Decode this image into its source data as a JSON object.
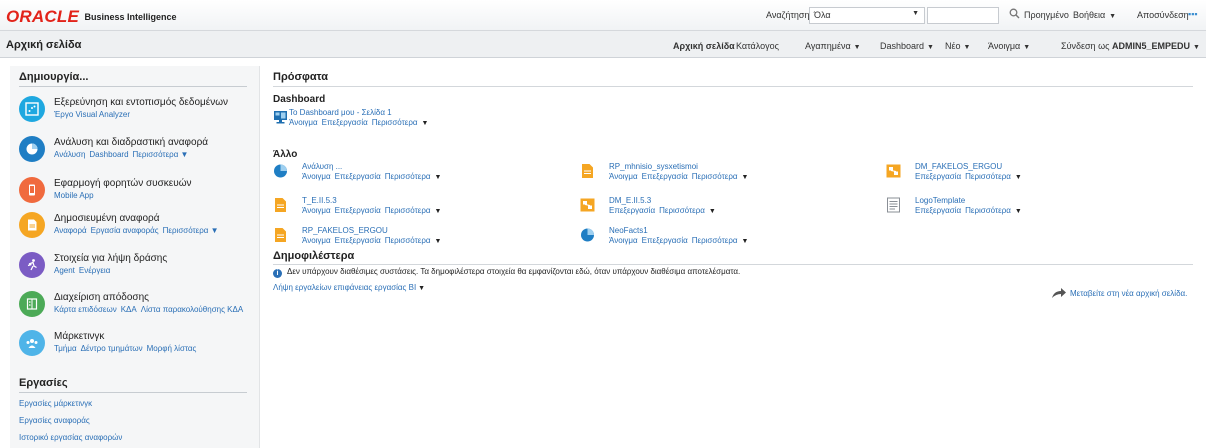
{
  "brand": {
    "oracle": "ORACLE",
    "product": "Business Intelligence",
    "color": "#e2231a"
  },
  "topbar": {
    "search_label": "Αναζήτηση",
    "search_scope": "Όλα",
    "search_value": "",
    "advanced": "Προηγμένο",
    "help": "Βοήθεια",
    "logout": "Αποσύνδεση",
    "dots": "▪▪▪",
    "icons": {
      "search": "search-icon",
      "chevron": "chevron-down-icon"
    }
  },
  "navbar": {
    "page_title": "Αρχική σελίδα",
    "home": "Αρχική σελίδα",
    "catalog": "Κατάλογος",
    "favorites": "Αγαπημένα",
    "dashboards": "Dashboard",
    "new": "Νέο",
    "open": "Άνοιγμα",
    "signed_in_prefix": "Σύνδεση ως",
    "user": "ADMIN5_EMPEDU"
  },
  "create": {
    "heading": "Δημιουργία...",
    "items": [
      {
        "title": "Εξερεύνηση και εντοπισμός δεδομένων",
        "links": [
          "Έργο Visual Analyzer"
        ],
        "icon": "data-explore-icon",
        "color": "#1fa8e0"
      },
      {
        "title": "Ανάλυση και διαδραστική αναφορά",
        "links": [
          "Ανάλυση",
          "Dashboard",
          "Περισσότερα ▼"
        ],
        "icon": "analysis-icon",
        "color": "#1f7ec4"
      },
      {
        "title": "Εφαρμογή φορητών συσκευών",
        "links": [
          "Mobile App"
        ],
        "icon": "mobile-icon",
        "color": "#f06a3e"
      },
      {
        "title": "Δημοσιευμένη αναφορά",
        "links": [
          "Αναφορά",
          "Εργασία αναφοράς",
          "Περισσότερα ▼"
        ],
        "icon": "published-report-icon",
        "color": "#f5a623"
      },
      {
        "title": "Στοιχεία για λήψη δράσης",
        "links": [
          "Agent",
          "Ενέργεια"
        ],
        "icon": "action-icon",
        "color": "#7b5cc4"
      },
      {
        "title": "Διαχείριση απόδοσης",
        "links": [
          "Κάρτα επιδόσεων",
          "ΚΔΑ",
          "Λίστα παρακολούθησης ΚΔΑ"
        ],
        "icon": "performance-icon",
        "color": "#4caa57"
      },
      {
        "title": "Μάρκετινγκ",
        "links": [
          "Τμήμα",
          "Δέντρο τμημάτων",
          "Μορφή λίστας"
        ],
        "icon": "marketing-icon",
        "color": "#4fb4e8"
      }
    ]
  },
  "tasks": {
    "heading": "Εργασίες",
    "links": [
      "Εργασίες μάρκετινγκ",
      "Εργασίες αναφοράς",
      "Ιστορικό εργασίας αναφορών"
    ]
  },
  "recent": {
    "heading": "Πρόσφατα",
    "dashboard_heading": "Dashboard",
    "dashboard_item": {
      "name": "Το Dashboard μου - Σελίδα 1",
      "actions": [
        "Άνοιγμα",
        "Επεξεργασία",
        "Περισσότερα"
      ]
    },
    "other_heading": "Άλλο",
    "other_items": [
      {
        "name": "Ανάλυση ...",
        "actions": [
          "Άνοιγμα",
          "Επεξεργασία",
          "Περισσότερα"
        ],
        "icon": "analysis-icon"
      },
      {
        "name": "T_E.II.5.3",
        "actions": [
          "Άνοιγμα",
          "Επεξεργασία",
          "Περισσότερα"
        ],
        "icon": "report-icon"
      },
      {
        "name": "RP_FAKELOS_ERGOU",
        "actions": [
          "Άνοιγμα",
          "Επεξεργασία",
          "Περισσότερα"
        ],
        "icon": "report-icon"
      },
      {
        "name": "RP_mhnisio_sysxetismoi",
        "actions": [
          "Άνοιγμα",
          "Επεξεργασία",
          "Περισσότερα"
        ],
        "icon": "report-icon"
      },
      {
        "name": "DM_E.II.5.3",
        "actions": [
          "Επεξεργασία",
          "Περισσότερα"
        ],
        "icon": "data-model-icon"
      },
      {
        "name": "NeoFacts1",
        "actions": [
          "Άνοιγμα",
          "Επεξεργασία",
          "Περισσότερα"
        ],
        "icon": "analysis-icon"
      },
      {
        "name": "DM_FAKELOS_ERGOU",
        "actions": [
          "Επεξεργασία",
          "Περισσότερα"
        ],
        "icon": "data-model-icon"
      },
      {
        "name": "LogoTemplate",
        "actions": [
          "Επεξεργασία",
          "Περισσότερα"
        ],
        "icon": "template-icon"
      }
    ]
  },
  "popular": {
    "heading": "Δημοφιλέστερα",
    "info": "Δεν υπάρχουν διαθέσιμες συστάσεις. Τα δημοφιλέστερα στοιχεία θα εμφανίζονται εδώ, όταν υπάρχουν διαθέσιμα αποτελέσματα.",
    "tools": "Λήψη εργαλείων επιφάνειας εργασίας BI",
    "new_home": "Μεταβείτε στη νέα αρχική σελίδα."
  }
}
